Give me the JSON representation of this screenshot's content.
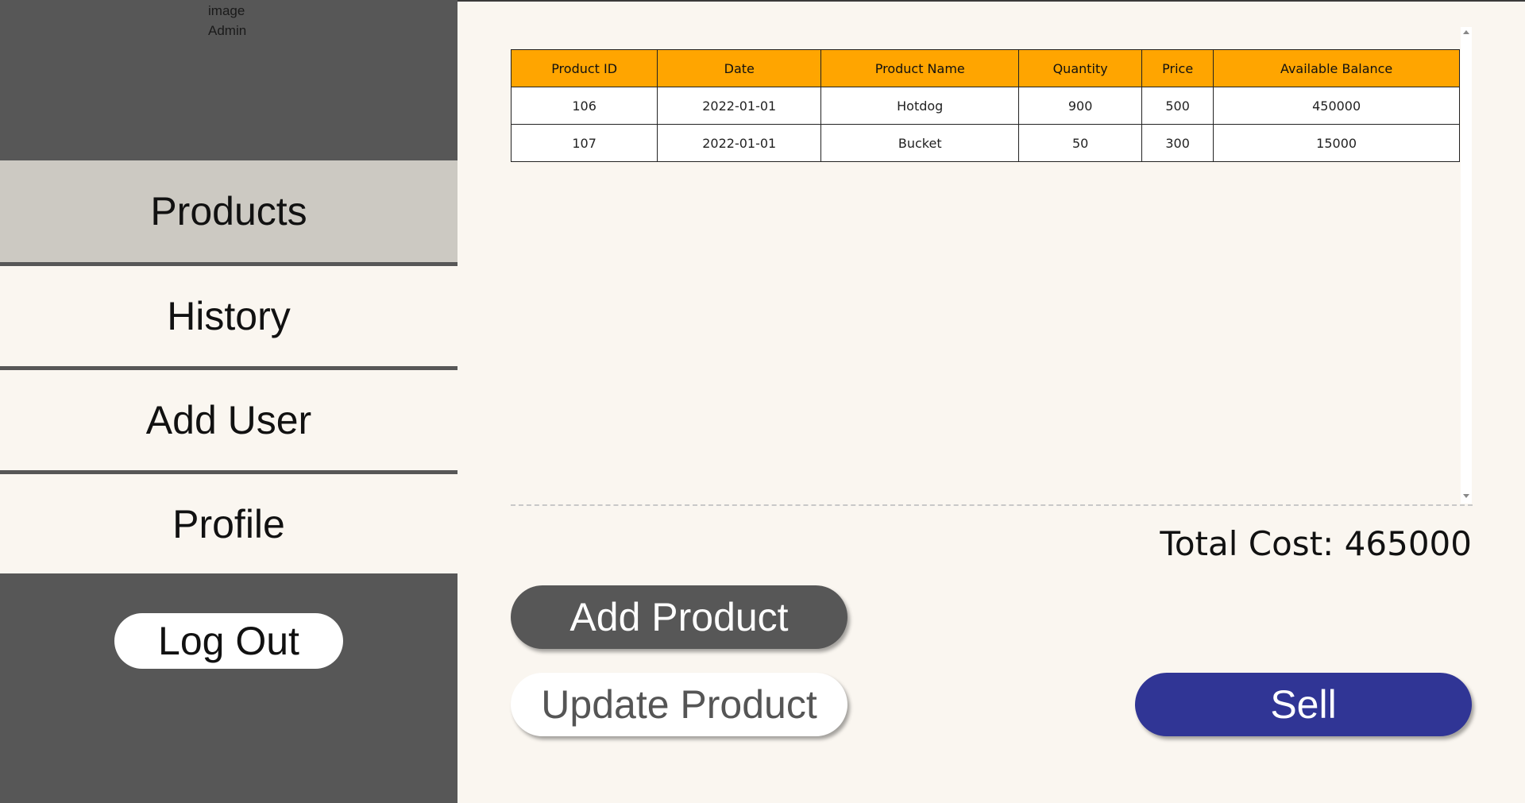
{
  "sidebar": {
    "profile_image_alt": "image",
    "profile_name": "Admin",
    "nav": [
      {
        "label": "Products"
      },
      {
        "label": "History"
      },
      {
        "label": "Add User"
      },
      {
        "label": "Profile"
      }
    ],
    "logout_label": "Log Out"
  },
  "table": {
    "headers": [
      "Product ID",
      "Date",
      "Product Name",
      "Quantity",
      "Price",
      "Available Balance"
    ],
    "rows": [
      [
        "106",
        "2022-01-01",
        "Hotdog",
        "900",
        "500",
        "450000"
      ],
      [
        "107",
        "2022-01-01",
        "Bucket",
        "50",
        "300",
        "15000"
      ]
    ]
  },
  "total_cost_text": "Total Cost: 465000",
  "buttons": {
    "add_product": "Add Product",
    "update_product": "Update Product",
    "sell": "Sell"
  },
  "colors": {
    "sidebar_bg": "#575757",
    "header_bg": "#ffa500",
    "sell_bg": "#303595",
    "page_bg": "#faf6f0"
  }
}
